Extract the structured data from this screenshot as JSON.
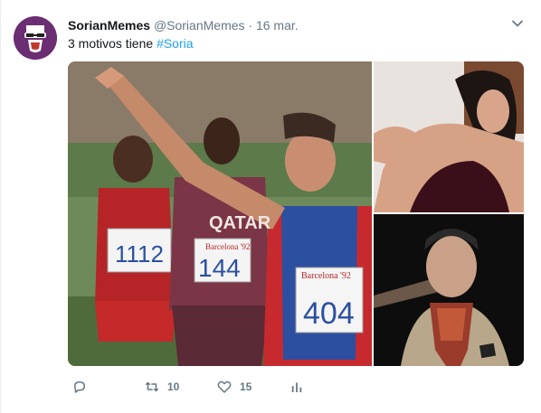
{
  "tweet": {
    "display_name": "SorianMemes",
    "handle": "@SorianMemes",
    "separator": "·",
    "date": "16 mar.",
    "text_prefix": "3 motivos tiene ",
    "hashtag": "#Soria",
    "actions": {
      "reply_icon": "reply-icon",
      "retweet_icon": "retweet-icon",
      "retweet_count": "10",
      "like_icon": "heart-icon",
      "like_count": "15",
      "stats_icon": "analytics-icon"
    },
    "media": {
      "photo1": {
        "bibs": [
          "1112",
          "144",
          "404"
        ],
        "sponsor": "QATAR",
        "event_label": "Barcelona '92"
      },
      "photo2": {},
      "photo3": {}
    }
  },
  "colors": {
    "link": "#1da1f2",
    "secondary_text": "#657786",
    "primary_text": "#14171a",
    "avatar_bg": "#6b2e72"
  }
}
